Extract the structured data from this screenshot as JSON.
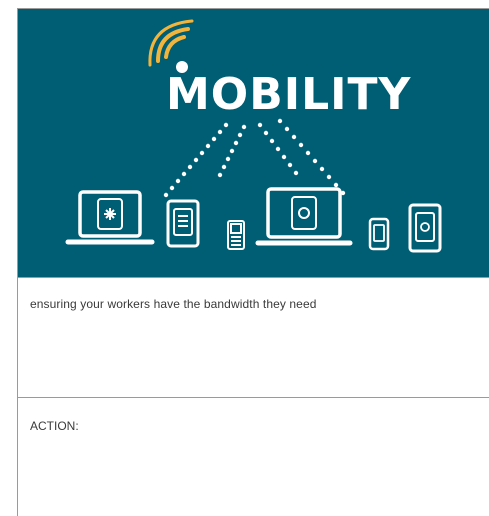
{
  "hero": {
    "logo_text": "MOBILITY",
    "background_color": "#005e74",
    "accent_color": "#f2b43a",
    "icons": [
      "wifi-signal-icon",
      "laptop-icon",
      "tablet-icon",
      "phone-icon",
      "laptop-icon",
      "phone-icon",
      "tablet-icon"
    ]
  },
  "caption": "ensuring your workers have the bandwidth they need",
  "action_label": "ACTION:"
}
